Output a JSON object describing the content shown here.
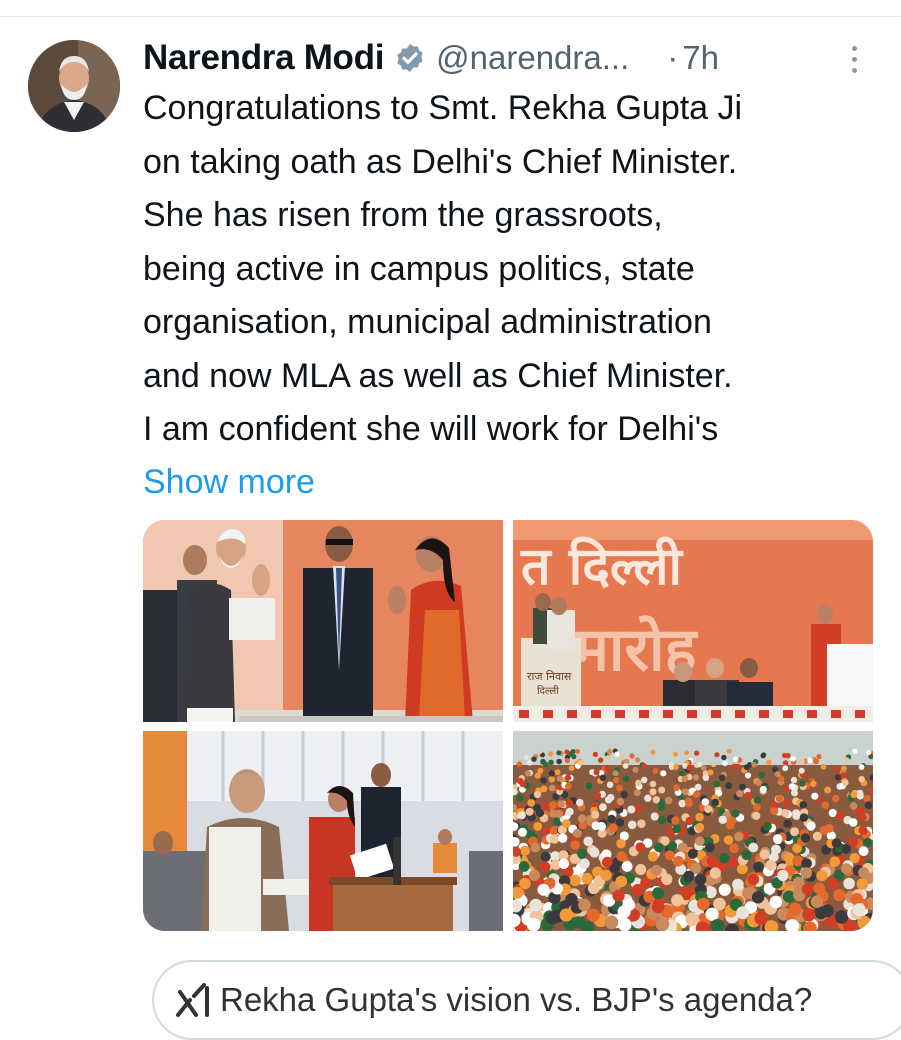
{
  "tweet": {
    "author_name": "Narendra Modi",
    "handle": "@narendra...",
    "separator": "·",
    "time": "7h",
    "text_lines": [
      "Congratulations to Smt. Rekha Gupta Ji",
      "on taking oath as Delhi's Chief Minister.",
      "She has risen from the grassroots,",
      "being active in campus politics, state",
      "organisation, municipal administration",
      "and now MLA as well as Chief Minister.",
      "I am confident she will work for Delhi's"
    ],
    "show_more": "Show more"
  },
  "media": {
    "photo2_banner_text": "त दिल्ली",
    "photo2_banner_text2": "मारोह",
    "photo2_podium_text": "राज निवास",
    "photo2_podium_text2": "दिल्ली"
  },
  "grok": {
    "suggestion": "Rekha Gupta's vision vs. BJP's agenda?"
  },
  "colors": {
    "link": "#1d9bf0",
    "verified_badge": "#829aab",
    "secondary_text": "#536471"
  },
  "icons": {
    "verified": "verified-badge-icon",
    "more": "more-vertical-icon",
    "grok": "grok-icon"
  }
}
